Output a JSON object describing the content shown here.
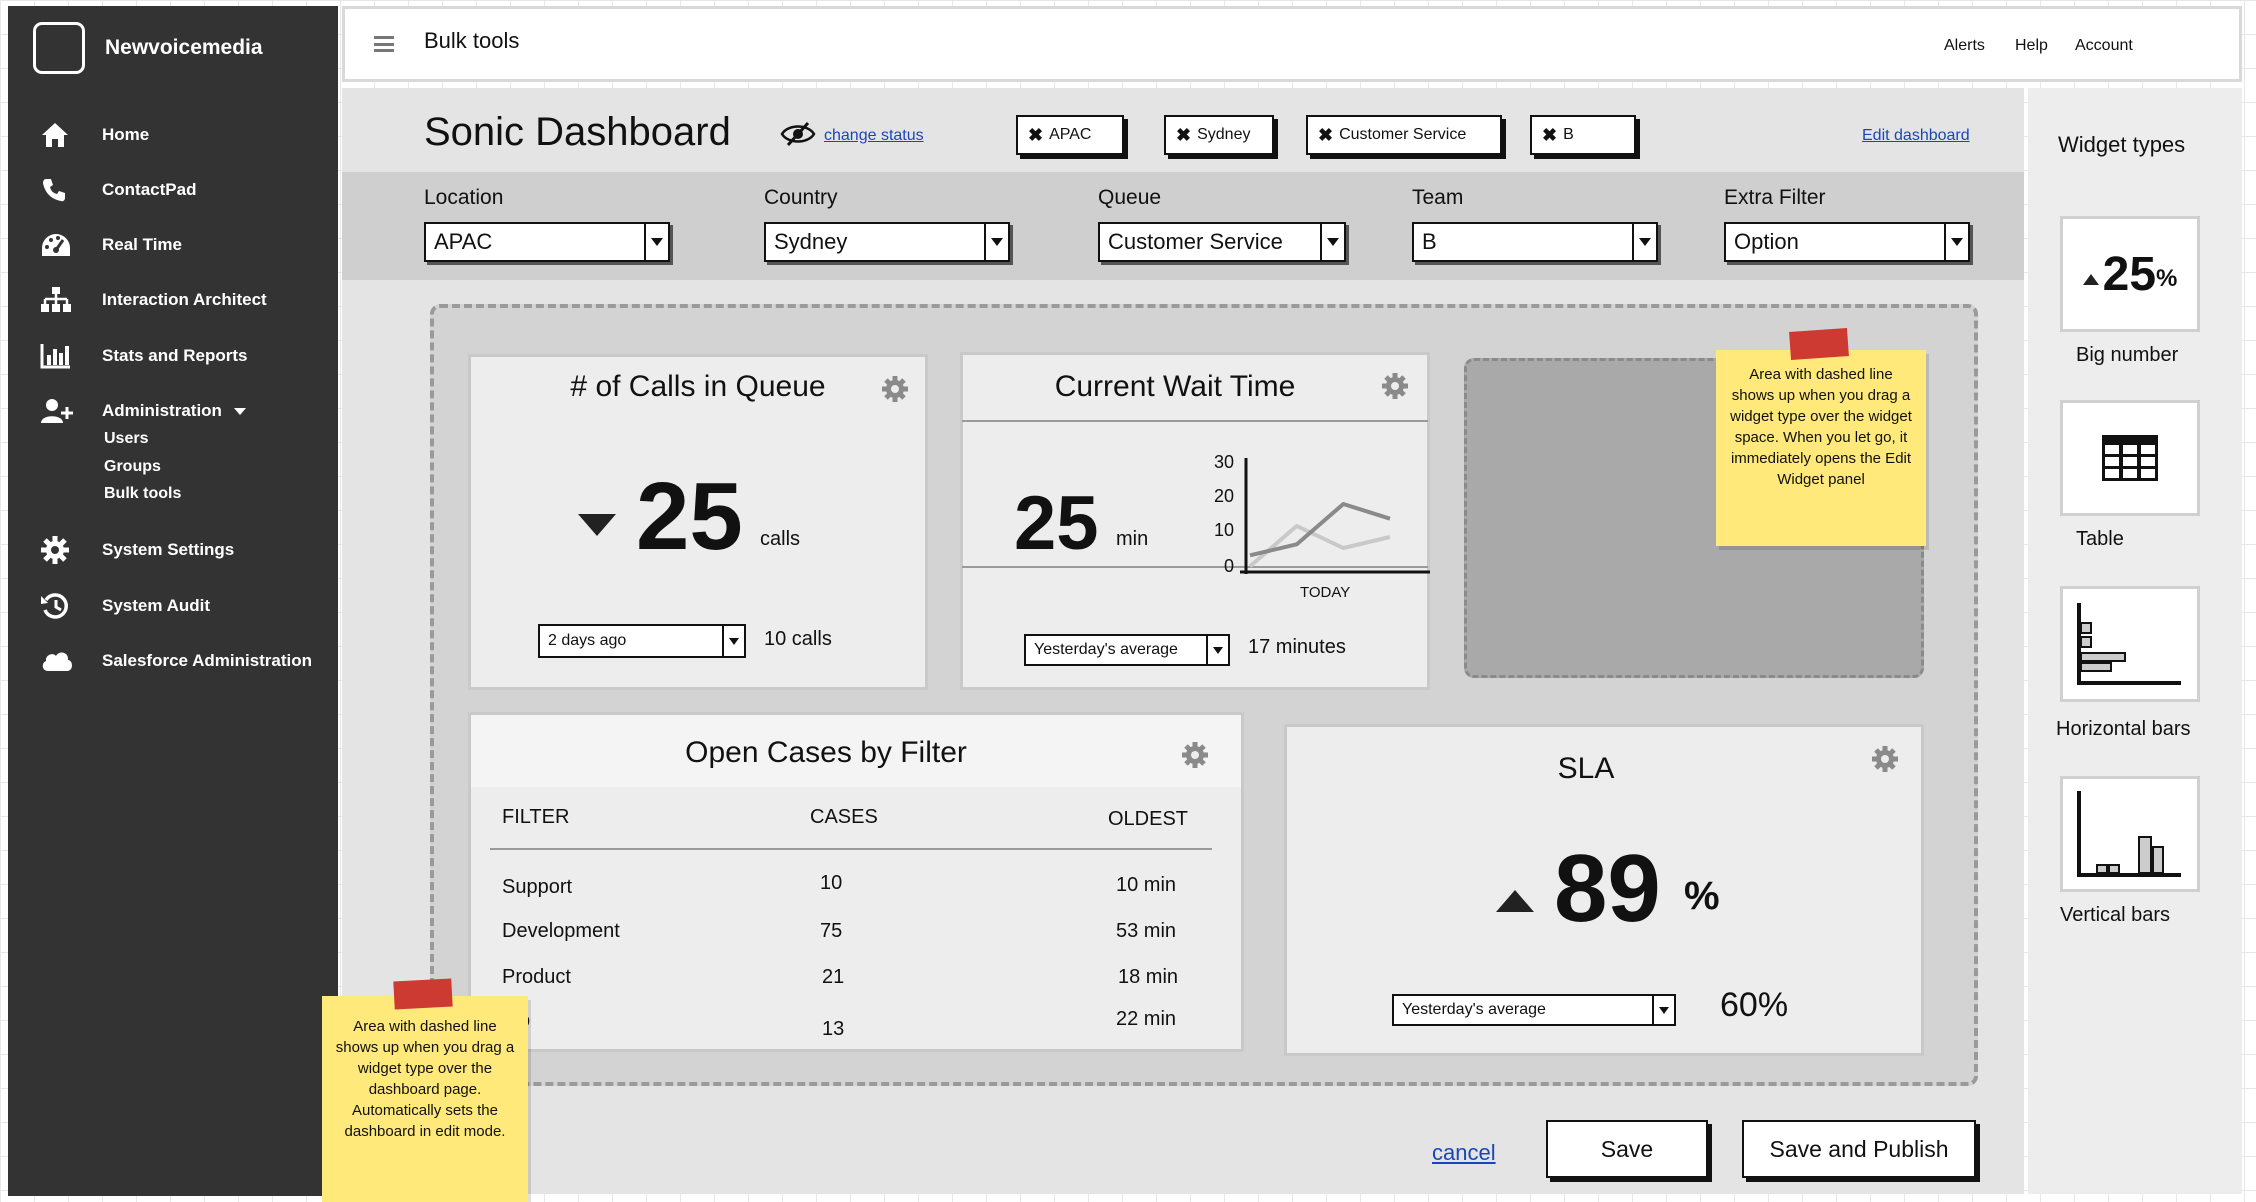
{
  "brand": {
    "name": "Newvoicemedia"
  },
  "sidebar": {
    "items": [
      {
        "label": "Home",
        "icon": "home-icon"
      },
      {
        "label": "ContactPad",
        "icon": "phone-icon"
      },
      {
        "label": "Real Time",
        "icon": "dashboard-gauge-icon"
      },
      {
        "label": "Interaction Architect",
        "icon": "sitemap-icon"
      },
      {
        "label": "Stats and Reports",
        "icon": "bar-chart-icon"
      },
      {
        "label": "Administration",
        "icon": "user-add-icon"
      },
      {
        "label": "System Settings",
        "icon": "gear-icon"
      },
      {
        "label": "System Audit",
        "icon": "history-icon"
      },
      {
        "label": "Salesforce Administration",
        "icon": "cloud-icon"
      }
    ],
    "admin_sub": [
      "Users",
      "Groups",
      "Bulk tools"
    ]
  },
  "header": {
    "title": "Bulk tools",
    "links": [
      "Alerts",
      "Help",
      "Account"
    ]
  },
  "dashboard": {
    "title": "Sonic Dashboard",
    "change_status": "change status",
    "edit_link": "Edit dashboard",
    "chips": [
      "APAC",
      "Sydney",
      "Customer Service",
      "B"
    ]
  },
  "filters": [
    {
      "label": "Location",
      "value": "APAC"
    },
    {
      "label": "Country",
      "value": "Sydney"
    },
    {
      "label": "Queue",
      "value": "Customer Service"
    },
    {
      "label": "Team",
      "value": "B"
    },
    {
      "label": "Extra Filter",
      "value": "Option"
    }
  ],
  "widgets": {
    "calls_queue": {
      "title": "# of Calls in Queue",
      "value": "25",
      "unit": "calls",
      "compare_select": "2 days ago",
      "compare_value": "10 calls"
    },
    "wait_time": {
      "title": "Current Wait Time",
      "value": "25",
      "unit": "min",
      "compare_select": "Yesterday's average",
      "compare_value": "17 minutes",
      "chart_xlabel": "TODAY",
      "chart_yticks": [
        "30",
        "20",
        "10",
        "0"
      ]
    },
    "open_cases": {
      "title": "Open Cases by Filter",
      "columns": [
        "FILTER",
        "CASES",
        "OLDEST"
      ],
      "rows": [
        [
          "Support",
          "10",
          "10 min"
        ],
        [
          "Development",
          "75",
          "53 min"
        ],
        [
          "Product",
          "21",
          "18 min"
        ],
        [
          "",
          "13",
          "22 min"
        ]
      ]
    },
    "sla": {
      "title": "SLA",
      "value": "89",
      "unit": "%",
      "compare_select": "Yesterday's average",
      "compare_value": "60%"
    }
  },
  "chart_data": {
    "type": "line",
    "xlabel": "TODAY",
    "ylim": [
      0,
      30
    ],
    "series": [
      {
        "x": [
          0,
          1,
          2,
          3
        ],
        "values": [
          4,
          7,
          18,
          14
        ],
        "color": "#8a8a8a"
      },
      {
        "x": [
          0,
          1,
          2,
          3
        ],
        "values": [
          1,
          12,
          6,
          9
        ],
        "color": "#c9c9c9"
      }
    ]
  },
  "notes": {
    "drop_zone": "Area with dashed line shows up when you drag a widget type over the widget space. When you let go, it immediately opens the Edit Widget panel",
    "dashboard": "Area with dashed line shows up when you drag a widget type over the dashboard page. Automatically sets the dashboard in edit mode."
  },
  "actions": {
    "cancel": "cancel",
    "save": "Save",
    "save_publish": "Save and Publish"
  },
  "widget_types": {
    "title": "Widget types",
    "big_number_preview": "25",
    "big_number_preview_unit": "%",
    "items": [
      "Big number",
      "Table",
      "Horizontal bars",
      "Vertical bars"
    ]
  }
}
